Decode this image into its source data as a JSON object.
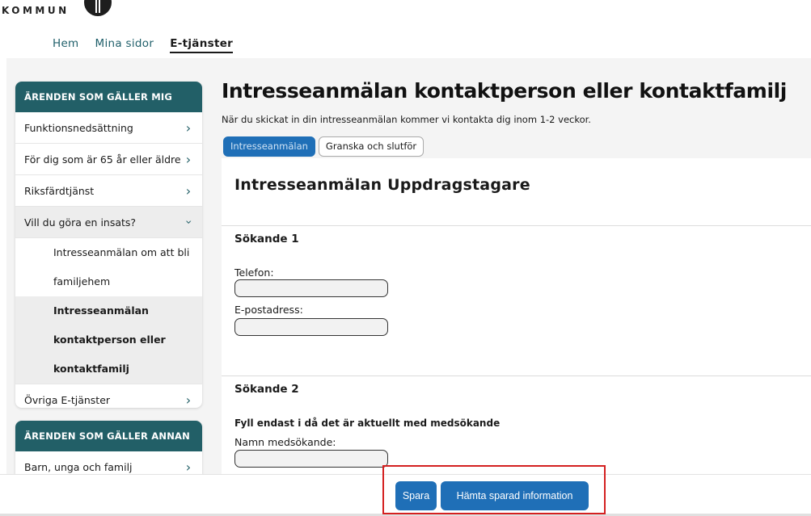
{
  "header": {
    "logo_text": "KOMMUN",
    "nav": [
      {
        "label": "Hem",
        "active": false
      },
      {
        "label": "Mina sidor",
        "active": false
      },
      {
        "label": "E-tjänster",
        "active": true
      }
    ]
  },
  "sidebar": {
    "section1": {
      "heading": "ÄRENDEN SOM GÄLLER MIG",
      "items": [
        {
          "label": "Funktionsnedsättning",
          "icon": "chevron-right-icon"
        },
        {
          "label": "För dig som är 65 år eller äldre",
          "icon": "chevron-right-icon"
        },
        {
          "label": "Riksfärdtjänst",
          "icon": "chevron-right-icon"
        },
        {
          "label": "Vill du göra en insats?",
          "icon": "chevron-down-icon",
          "expanded": true
        },
        {
          "label": "Övriga E-tjänster",
          "icon": "chevron-right-icon"
        }
      ],
      "subitems": [
        {
          "lines": [
            "Intresseanmälan om att bli",
            "familjehem"
          ],
          "active": false
        },
        {
          "lines": [
            "Intresseanmälan",
            "kontaktperson eller",
            "kontaktfamilj"
          ],
          "active": true
        }
      ]
    },
    "section2": {
      "heading": "ÄRENDEN SOM GÄLLER ANNAN",
      "items": [
        {
          "label": "Barn, unga och familj",
          "icon": "chevron-right-icon"
        }
      ]
    }
  },
  "main": {
    "title": "Intresseanmälan kontaktperson eller kontaktfamilj",
    "intro": "När du skickat in din intresseanmälan kommer vi kontakta dig inom 1-2 veckor.",
    "steps": [
      {
        "label": "Intresseanmälan",
        "active": true
      },
      {
        "label": "Granska och slutför",
        "active": false
      }
    ],
    "form": {
      "title": "Intresseanmälan Uppdragstagare",
      "section1": {
        "heading": "Sökande 1",
        "fields": [
          {
            "label": "Telefon:",
            "value": ""
          },
          {
            "label": "E-postadress:",
            "value": ""
          }
        ]
      },
      "section2": {
        "heading": "Sökande 2",
        "hint": "Fyll endast i då det är aktuellt med medsökande",
        "fields": [
          {
            "label": "Namn medsökande:",
            "value": ""
          }
        ]
      }
    }
  },
  "actions": {
    "save_label": "Spara",
    "fetch_label": "Hämta sparad information"
  },
  "colors": {
    "sidebar_header": "#225f67",
    "primary_button": "#1f6fb7",
    "highlight_border": "#d42020"
  }
}
